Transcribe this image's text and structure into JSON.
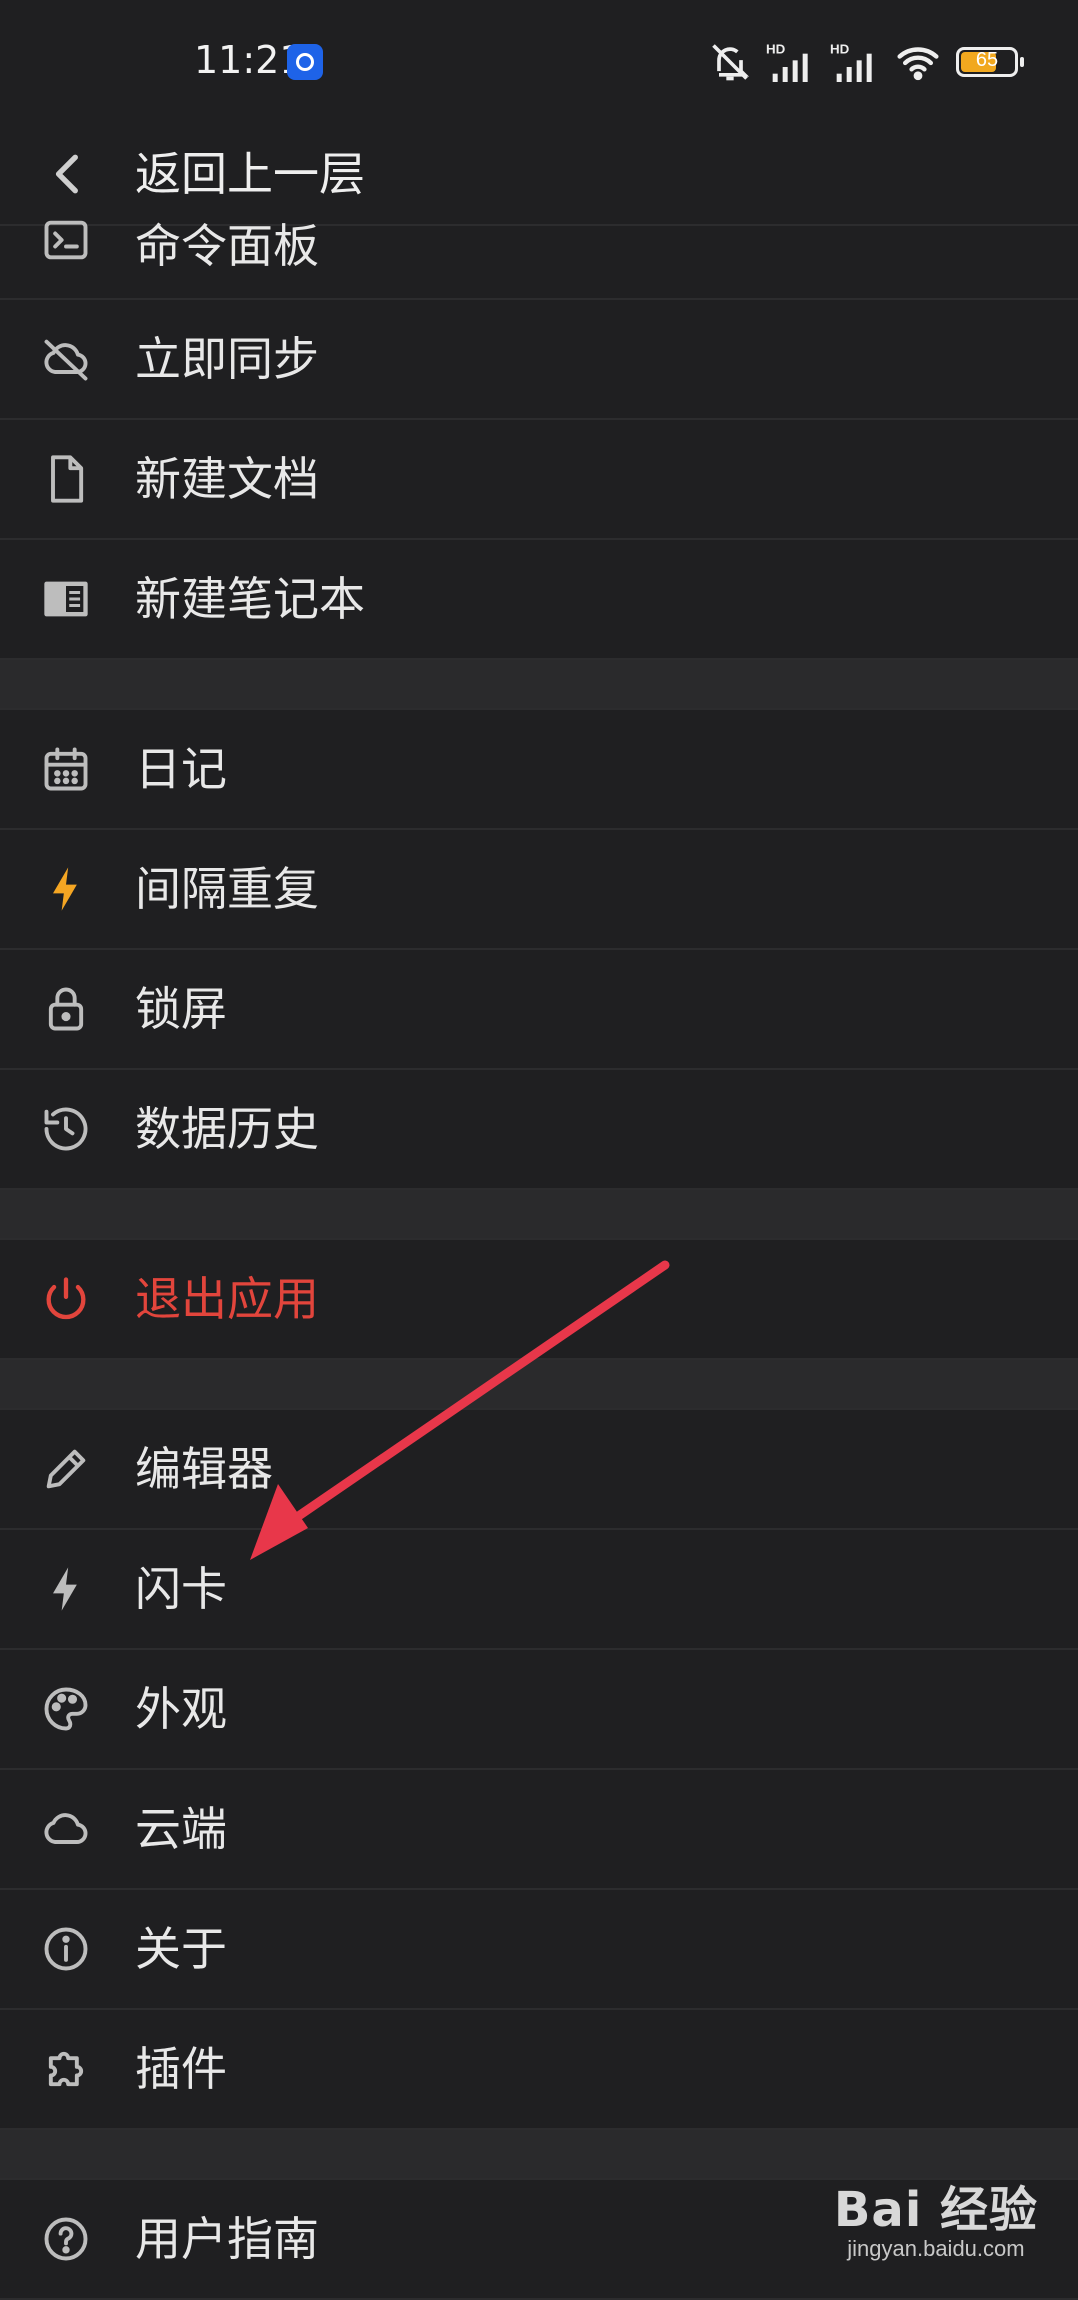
{
  "status_bar": {
    "time": "11:21",
    "battery": "65",
    "icons": [
      "mute-icon",
      "signal-hd-icon",
      "signal-hd-icon",
      "wifi-icon",
      "battery-icon"
    ]
  },
  "header": {
    "title": "返回上一层",
    "icon": "chevron-left-icon"
  },
  "menu": {
    "group1": [
      {
        "label": "命令面板",
        "icon": "terminal-icon"
      },
      {
        "label": "立即同步",
        "icon": "cloud-off-icon"
      },
      {
        "label": "新建文档",
        "icon": "file-icon"
      },
      {
        "label": "新建笔记本",
        "icon": "notebook-icon"
      }
    ],
    "group2": [
      {
        "label": "日记",
        "icon": "calendar-icon"
      },
      {
        "label": "间隔重复",
        "icon": "lightning-icon",
        "icon_color": "#f5a623"
      },
      {
        "label": "锁屏",
        "icon": "lock-icon"
      },
      {
        "label": "数据历史",
        "icon": "history-icon"
      }
    ],
    "group3": [
      {
        "label": "退出应用",
        "icon": "power-icon",
        "color": "#e2453c"
      }
    ],
    "group4": [
      {
        "label": "编辑器",
        "icon": "pencil-icon"
      },
      {
        "label": "闪卡",
        "icon": "lightning-icon"
      },
      {
        "label": "外观",
        "icon": "palette-icon"
      },
      {
        "label": "云端",
        "icon": "cloud-icon"
      },
      {
        "label": "关于",
        "icon": "info-icon"
      },
      {
        "label": "插件",
        "icon": "puzzle-icon"
      }
    ],
    "group5": [
      {
        "label": "用户指南",
        "icon": "help-icon"
      }
    ]
  },
  "annotation": {
    "arrow_color": "#e8374a"
  },
  "watermark": {
    "logo": "Bai 经验",
    "url": "jingyan.baidu.com"
  }
}
